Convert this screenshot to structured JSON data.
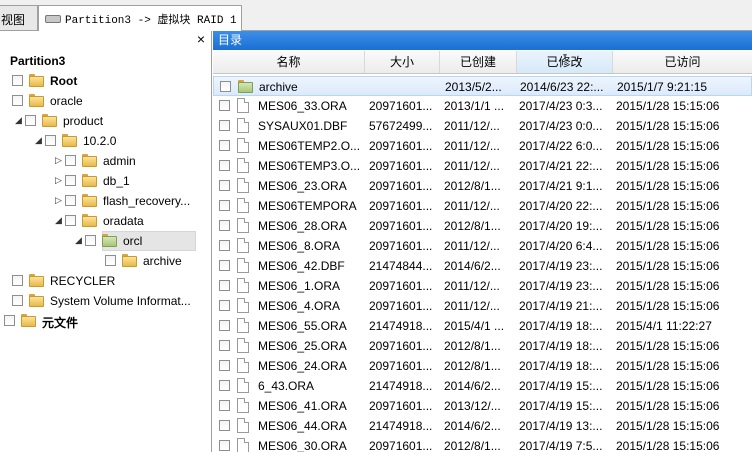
{
  "tabs": [
    {
      "label": "视图"
    },
    {
      "label": "Partition3 -> 虚拟块 RAID 1"
    }
  ],
  "tree": {
    "close_label": "×",
    "nodes": [
      {
        "label": "Partition3",
        "expanded": true,
        "icon": "none"
      },
      {
        "label": "Root",
        "expanded": true,
        "icon": "folder-icon"
      },
      {
        "label": "oracle",
        "expanded": true,
        "icon": "folder-icon"
      },
      {
        "label": "product",
        "expanded": true,
        "icon": "folder-icon"
      },
      {
        "label": "10.2.0",
        "expanded": true,
        "icon": "folder-icon"
      },
      {
        "label": "admin",
        "expanded": false,
        "icon": "folder-icon"
      },
      {
        "label": "db_1",
        "expanded": false,
        "icon": "folder-icon"
      },
      {
        "label": "flash_recovery...",
        "expanded": false,
        "icon": "folder-icon"
      },
      {
        "label": "oradata",
        "expanded": true,
        "icon": "folder-icon"
      },
      {
        "label": "orcl",
        "expanded": true,
        "icon": "folder-green-icon",
        "selected": true
      },
      {
        "label": "archive",
        "icon": "folder-icon"
      },
      {
        "label": "RECYCLER",
        "icon": "folder-icon"
      },
      {
        "label": "System Volume Informat...",
        "icon": "folder-icon"
      },
      {
        "label": "元文件",
        "icon": "folder-icon"
      }
    ]
  },
  "directory_header": "目录",
  "columns": {
    "name": "名称",
    "size": "大小",
    "created": "已创建",
    "modified": "已修改",
    "accessed": "已访问"
  },
  "files": [
    {
      "name": "archive",
      "size": "",
      "created": "2013/5/2...",
      "modified": "2014/6/23 22:...",
      "accessed": "2015/1/7 9:21:15",
      "type": "folder",
      "highlighted": true
    },
    {
      "name": "MES06_33.ORA",
      "size": "20971601...",
      "created": "2013/1/1 ...",
      "modified": "2017/4/23 0:3...",
      "accessed": "2015/1/28 15:15:06",
      "type": "file"
    },
    {
      "name": "SYSAUX01.DBF",
      "size": "57672499...",
      "created": "2011/12/...",
      "modified": "2017/4/23 0:0...",
      "accessed": "2015/1/28 15:15:06",
      "type": "file"
    },
    {
      "name": "MES06TEMP2.O...",
      "size": "20971601...",
      "created": "2011/12/...",
      "modified": "2017/4/22 6:0...",
      "accessed": "2015/1/28 15:15:06",
      "type": "file"
    },
    {
      "name": "MES06TEMP3.O...",
      "size": "20971601...",
      "created": "2011/12/...",
      "modified": "2017/4/21 22:...",
      "accessed": "2015/1/28 15:15:06",
      "type": "file"
    },
    {
      "name": "MES06_23.ORA",
      "size": "20971601...",
      "created": "2012/8/1...",
      "modified": "2017/4/21 9:1...",
      "accessed": "2015/1/28 15:15:06",
      "type": "file"
    },
    {
      "name": "MES06TEMPORA",
      "size": "20971601...",
      "created": "2011/12/...",
      "modified": "2017/4/20 22:...",
      "accessed": "2015/1/28 15:15:06",
      "type": "file"
    },
    {
      "name": "MES06_28.ORA",
      "size": "20971601...",
      "created": "2012/8/1...",
      "modified": "2017/4/20 19:...",
      "accessed": "2015/1/28 15:15:06",
      "type": "file"
    },
    {
      "name": "MES06_8.ORA",
      "size": "20971601...",
      "created": "2011/12/...",
      "modified": "2017/4/20 6:4...",
      "accessed": "2015/1/28 15:15:06",
      "type": "file"
    },
    {
      "name": "MES06_42.DBF",
      "size": "21474844...",
      "created": "2014/6/2...",
      "modified": "2017/4/19 23:...",
      "accessed": "2015/1/28 15:15:06",
      "type": "file"
    },
    {
      "name": "MES06_1.ORA",
      "size": "20971601...",
      "created": "2011/12/...",
      "modified": "2017/4/19 23:...",
      "accessed": "2015/1/28 15:15:06",
      "type": "file"
    },
    {
      "name": "MES06_4.ORA",
      "size": "20971601...",
      "created": "2011/12/...",
      "modified": "2017/4/19 21:...",
      "accessed": "2015/1/28 15:15:06",
      "type": "file"
    },
    {
      "name": "MES06_55.ORA",
      "size": "21474918...",
      "created": "2015/4/1 ...",
      "modified": "2017/4/19 18:...",
      "accessed": "2015/4/1 11:22:27",
      "type": "file"
    },
    {
      "name": "MES06_25.ORA",
      "size": "20971601...",
      "created": "2012/8/1...",
      "modified": "2017/4/19 18:...",
      "accessed": "2015/1/28 15:15:06",
      "type": "file"
    },
    {
      "name": "MES06_24.ORA",
      "size": "20971601...",
      "created": "2012/8/1...",
      "modified": "2017/4/19 18:...",
      "accessed": "2015/1/28 15:15:06",
      "type": "file"
    },
    {
      "name": "6_43.ORA",
      "size": "21474918...",
      "created": "2014/6/2...",
      "modified": "2017/4/19 15:...",
      "accessed": "2015/1/28 15:15:06",
      "type": "file"
    },
    {
      "name": "MES06_41.ORA",
      "size": "20971601...",
      "created": "2013/12/...",
      "modified": "2017/4/19 15:...",
      "accessed": "2015/1/28 15:15:06",
      "type": "file"
    },
    {
      "name": "MES06_44.ORA",
      "size": "21474918...",
      "created": "2014/6/2...",
      "modified": "2017/4/19 13:...",
      "accessed": "2015/1/28 15:15:06",
      "type": "file"
    },
    {
      "name": "MES06_30.ORA",
      "size": "20971601...",
      "created": "2012/8/1...",
      "modified": "2017/4/19 7:5...",
      "accessed": "2015/1/28 15:15:06",
      "type": "file"
    }
  ]
}
